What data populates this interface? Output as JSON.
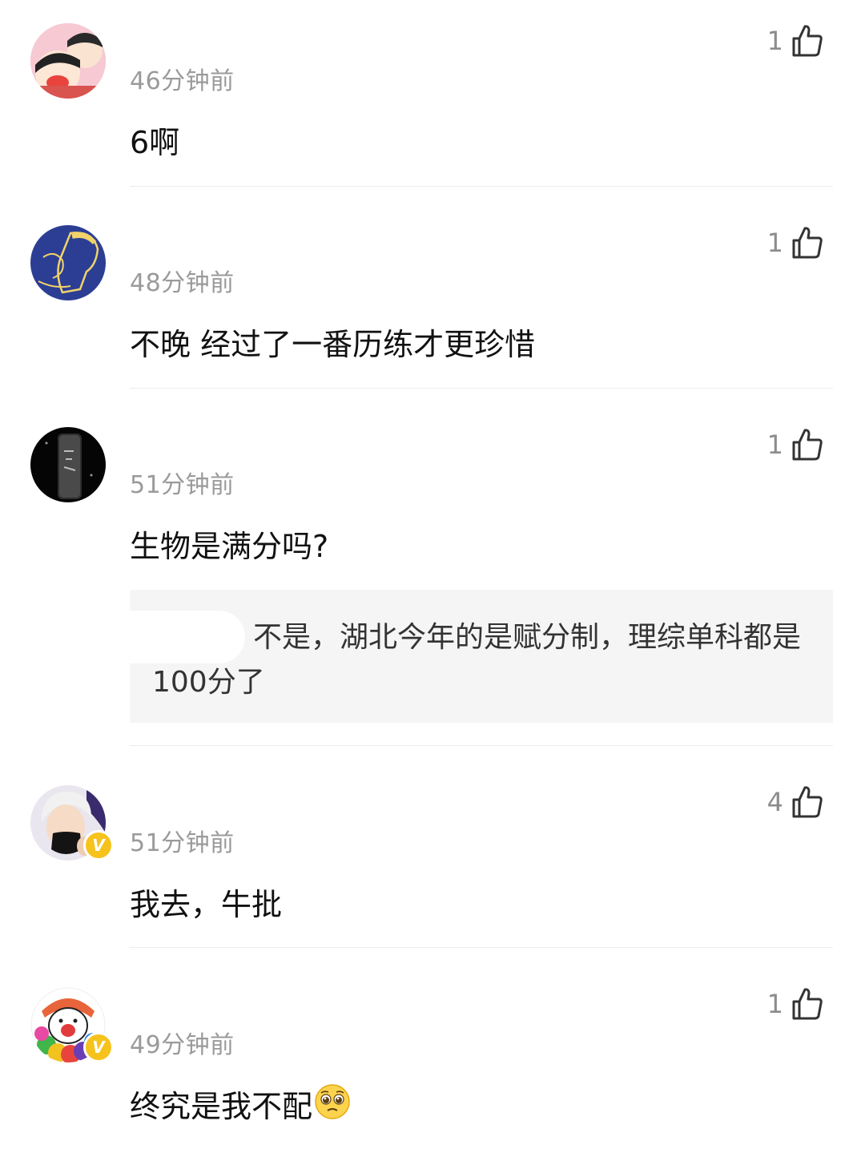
{
  "comments": [
    {
      "avatar": "avatar-cartoon-kids",
      "name": "",
      "time": "46分钟前",
      "text": "6啊",
      "likes": "1",
      "verified": false
    },
    {
      "avatar": "avatar-blue-illustration",
      "name": "",
      "time": "48分钟前",
      "text": "不晚 经过了一番历练才更珍惜",
      "likes": "1",
      "verified": false
    },
    {
      "avatar": "avatar-dark-bottle",
      "name": "",
      "time": "51分钟前",
      "text": "生物是满分吗?",
      "likes": "1",
      "verified": false,
      "reply": {
        "author": "",
        "text": "不是，湖北今年的是赋分制，理综单科都是100分了"
      }
    },
    {
      "avatar": "avatar-person-mask",
      "name": "",
      "time": "51分钟前",
      "text": "我去，牛批",
      "likes": "4",
      "verified": true
    },
    {
      "avatar": "avatar-clown",
      "name": "",
      "time": "49分钟前",
      "text": "终究是我不配",
      "emoji": "pleading-face-emoji",
      "likes": "1",
      "verified": true
    }
  ],
  "like_icon": "thumbs-up-outline-icon",
  "verified_badge": "V",
  "colors": {
    "time": "#9a9a9a",
    "badge": "#f6c21c",
    "reply_bg": "#f5f5f5",
    "divider": "#ececec"
  }
}
